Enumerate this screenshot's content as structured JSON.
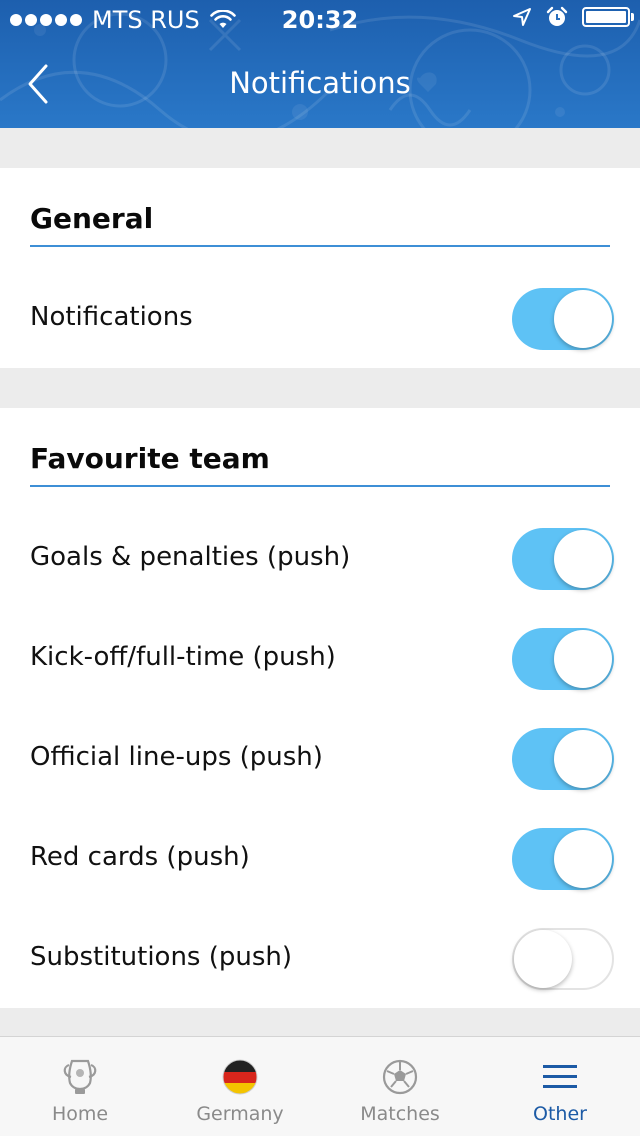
{
  "status_bar": {
    "carrier": "MTS RUS",
    "time": "20:32"
  },
  "nav": {
    "title": "Notifications"
  },
  "sections": [
    {
      "heading": "General",
      "rows": [
        {
          "label": "Notifications",
          "enabled": true
        }
      ]
    },
    {
      "heading": "Favourite team",
      "rows": [
        {
          "label": "Goals & penalties (push)",
          "enabled": true
        },
        {
          "label": "Kick-off/full-time (push)",
          "enabled": true
        },
        {
          "label": "Official line-ups (push)",
          "enabled": true
        },
        {
          "label": "Red cards (push)",
          "enabled": true
        },
        {
          "label": "Substitutions (push)",
          "enabled": false
        }
      ]
    }
  ],
  "tabs": [
    {
      "label": "Home",
      "icon": "trophy-icon",
      "active": false
    },
    {
      "label": "Germany",
      "icon": "germany-flag-icon",
      "active": false
    },
    {
      "label": "Matches",
      "icon": "football-icon",
      "active": false
    },
    {
      "label": "Other",
      "icon": "menu-icon",
      "active": true
    }
  ],
  "colors": {
    "header": "#2a78c8",
    "toggle_on": "#5ec2f5",
    "section_rule": "#3d8fd6",
    "active_tab": "#1c5aa5"
  }
}
